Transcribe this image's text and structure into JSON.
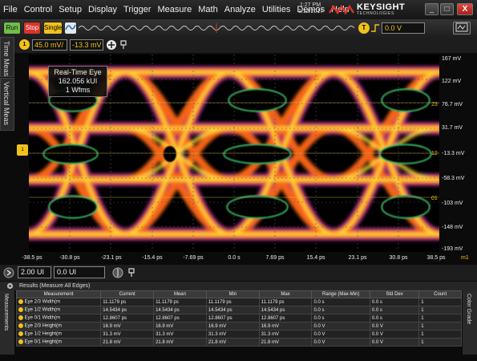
{
  "menu": [
    "File",
    "Control",
    "Setup",
    "Display",
    "Trigger",
    "Measure",
    "Math",
    "Analyze",
    "Utilities",
    "Demos",
    "Help"
  ],
  "clock": {
    "time": "1:27 PM",
    "date": "1/12/2017"
  },
  "brand": {
    "name": "KEYSIGHT",
    "sub": "TECHNOLOGIES"
  },
  "window_buttons": {
    "minimize": "_",
    "restore": "□",
    "close": "X"
  },
  "controls": {
    "run": "Run",
    "stop": "Stop",
    "single": "Single",
    "trigger_level": "0.0 V",
    "trigger_label": "T"
  },
  "colors": {
    "run": "#6fbf4a",
    "stop": "#d9342b",
    "single": "#f2c21b",
    "accent": "#f2c21b"
  },
  "channel": {
    "label": "1",
    "scale": "45.0 mV/",
    "offset": "-13.3 mV"
  },
  "side_tabs": {
    "time_meas": "Time Meas",
    "vertical_meas": "Vertical Meas"
  },
  "eye_info": {
    "title": "Real-Time Eye",
    "rate": "162.056 kUI",
    "waveforms": "1 Wfms"
  },
  "y_axis": [
    "167 mV",
    "122 mV",
    "76.7 mV",
    "31.7 mV",
    "-13.3 mV",
    "-58.3 mV",
    "-103 mV",
    "-148 mV",
    "-193 mV"
  ],
  "markers": {
    "m23": "23",
    "m12": "12",
    "m01": "01",
    "m1": "m1"
  },
  "x_axis": [
    "-38.5 ps",
    "-30.8 ps",
    "-23.1 ps",
    "-15.4 ps",
    "-7.69 ps",
    "0.0 s",
    "7.69 ps",
    "15.4 ps",
    "23.1 ps",
    "30.8 ps",
    "38.5 ps"
  ],
  "timebase": {
    "scale": "2.00 UI",
    "position": "0.0 UI"
  },
  "results": {
    "title": "Results   (Measure All Edges)",
    "columns": [
      "Measurement",
      "Current",
      "Mean",
      "Min",
      "Max",
      "Range (Max-Min)",
      "Std Dev",
      "Count"
    ],
    "rows": [
      [
        "Eye 2/3 Width(m",
        "11.1179 ps",
        "11.1179 ps",
        "11.1179 ps",
        "11.1179 ps",
        "0.0 s",
        "0.0 s",
        "1"
      ],
      [
        "Eye 1/2 Width(m",
        "14.5434 ps",
        "14.5434 ps",
        "14.5434 ps",
        "14.5434 ps",
        "0.0 s",
        "0.0 s",
        "1"
      ],
      [
        "Eye 0/1 Width(m",
        "12.8607 ps",
        "12.8607 ps",
        "12.8607 ps",
        "12.8607 ps",
        "0.0 s",
        "0.0 s",
        "1"
      ],
      [
        "Eye 2/3 Height(m",
        "16.9 mV",
        "16.9 mV",
        "16.9 mV",
        "16.9 mV",
        "0.0 V",
        "0.0 V",
        "1"
      ],
      [
        "Eye 1/2 Height(m",
        "31.3 mV",
        "31.3 mV",
        "31.3 mV",
        "31.3 mV",
        "0.0 V",
        "0.0 V",
        "1"
      ],
      [
        "Eye 0/1 Height(m",
        "21.8 mV",
        "21.8 mV",
        "21.8 mV",
        "21.8 mV",
        "0.0 V",
        "0.0 V",
        "1"
      ]
    ],
    "side_left": "Measurements",
    "side_right": "Color Grade"
  }
}
